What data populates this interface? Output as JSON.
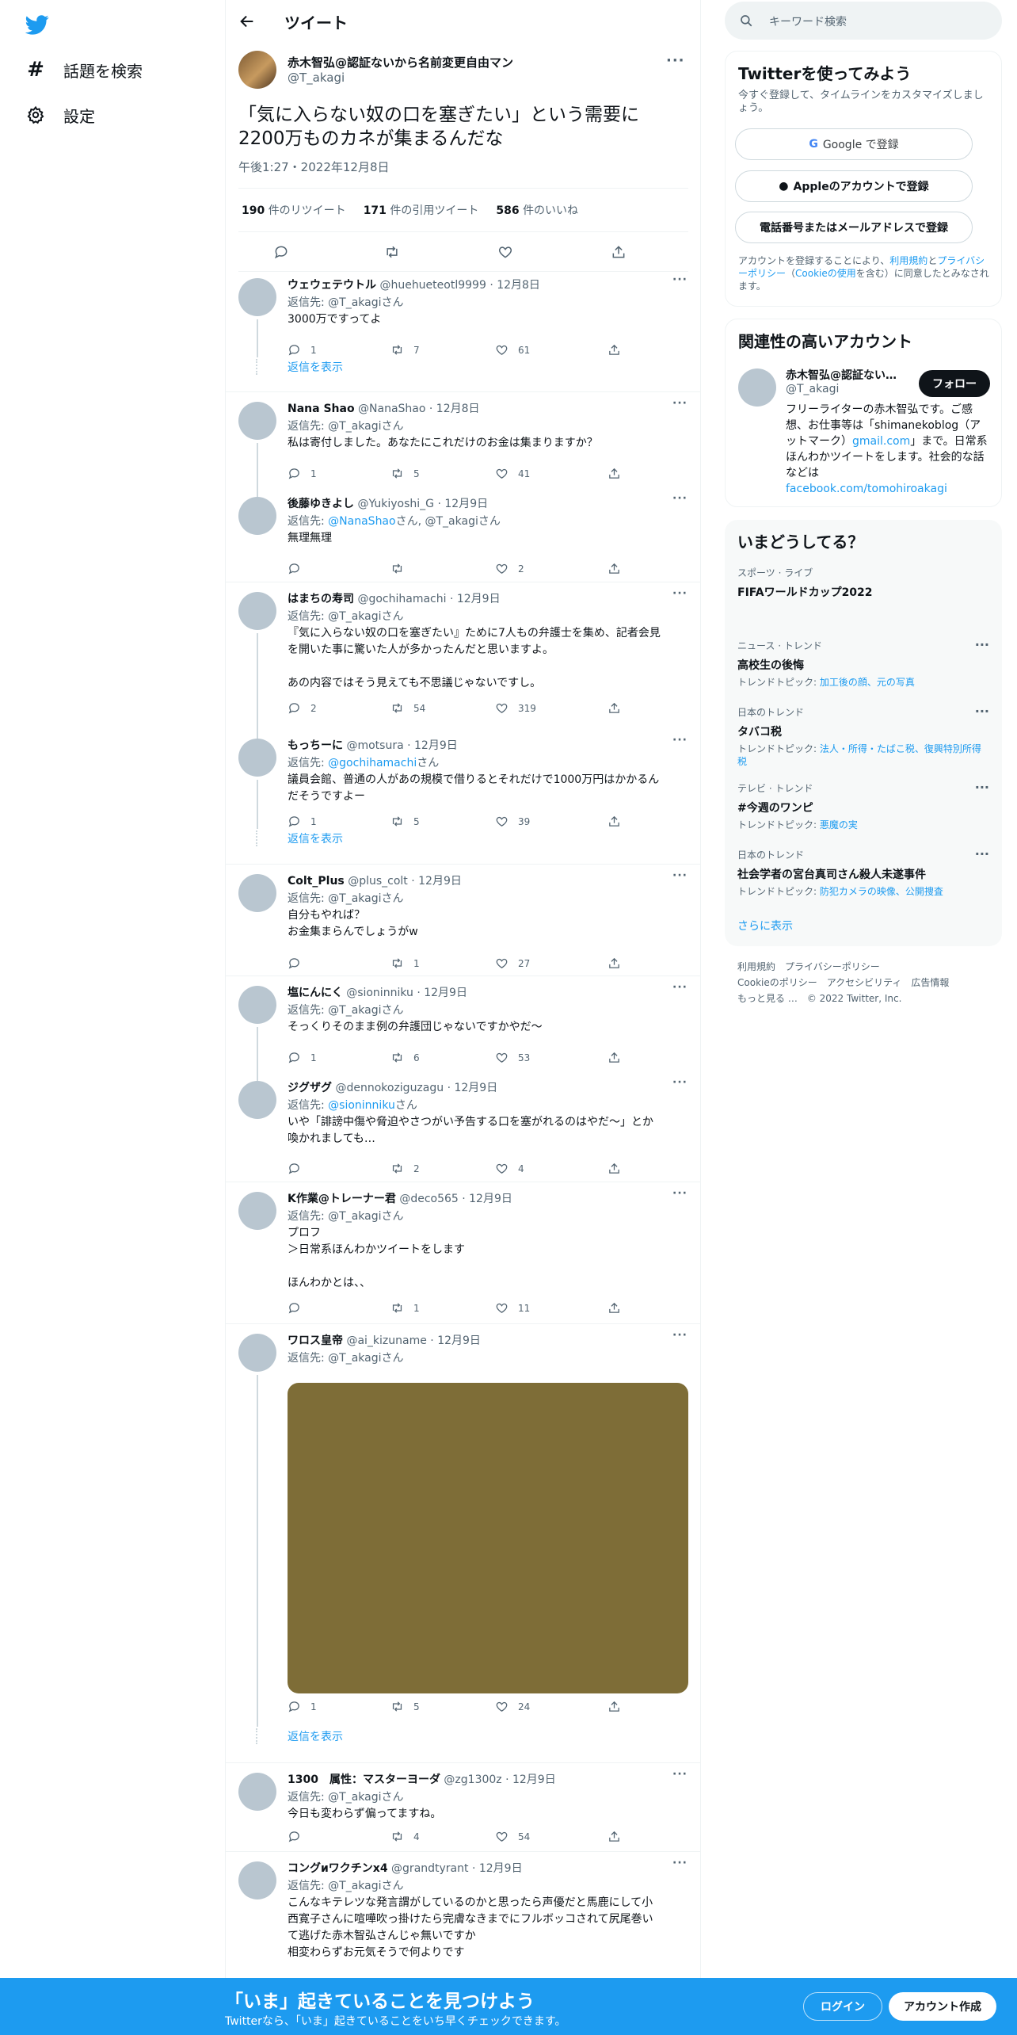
{
  "nav": {
    "explore_label": "話題を検索",
    "settings_label": "設定"
  },
  "header": {
    "title": "ツイート"
  },
  "main_tweet": {
    "name": "赤木智弘@認証ないから名前変更自由マン",
    "handle": "@T_akagi",
    "text": "「気に入らない奴の口を塞ぎたい」という需要に\n2200万ものカネが集まるんだな",
    "time": "午後1:27・2022年12月8日",
    "retweets": "190",
    "retweets_label": "件のリツイート",
    "quotes": "171",
    "quotes_label": "件の引用ツイート",
    "likes": "586",
    "likes_label": "件のいいね"
  },
  "replies": [
    {
      "name": "ウェウェテウトル",
      "handle": "@huehueteotl9999",
      "date": "· 12月8日",
      "to_prefix": "返信先: ",
      "to": "@T_akagiさん",
      "text": "3000万ですってよ",
      "reply": "1",
      "rt": "7",
      "like": "61",
      "show_more": "返信を表示"
    },
    {
      "name": "Nana  Shao",
      "handle": "@NanaShao",
      "date": "· 12月8日",
      "to_prefix": "返信先: ",
      "to": "@T_akagiさん",
      "text": "私は寄付しました。あなたにこれだけのお金は集まりますか？",
      "reply": "1",
      "rt": "5",
      "like": "41"
    },
    {
      "name": "後藤ゆきよし",
      "handle": "@Yukiyoshi_G",
      "date": "· 12月9日",
      "to_prefix": "返信先: ",
      "to_link": "@NanaShao",
      "to_mid": "さん, ",
      "to": "@T_akagiさん",
      "text": "無理無理",
      "reply": "",
      "rt": "",
      "like": "2"
    },
    {
      "name": "はまちの寿司",
      "handle": "@gochihamachi",
      "date": "· 12月9日",
      "to_prefix": "返信先: ",
      "to": "@T_akagiさん",
      "text": "『気に入らない奴の口を塞ぎたい』ために7人もの弁護士を集め、記者会見\nを開いた事に驚いた人が多かったんだと思いますよ。\n\nあの内容ではそう見えても不思議じゃないですし。",
      "reply": "2",
      "rt": "54",
      "like": "319"
    },
    {
      "name": "もっちーに",
      "handle": "@motsura",
      "date": "· 12月9日",
      "to_prefix": "返信先: ",
      "to_link": "@gochihamachi",
      "to_mid": "さん",
      "to": "",
      "text": "議員会館、普通の人があの規模で借りるとそれだけで1000万円はかかるん\nだそうですよー",
      "reply": "1",
      "rt": "5",
      "like": "39",
      "show_more": "返信を表示"
    },
    {
      "name": "Colt_Plus",
      "handle": "@plus_colt",
      "date": "· 12月9日",
      "to_prefix": "返信先: ",
      "to": "@T_akagiさん",
      "text": "自分もやれば？\nお金集まらんでしょうがw",
      "reply": "",
      "rt": "1",
      "like": "27"
    },
    {
      "name": "塩にんにく",
      "handle": "@sioninniku",
      "date": "· 12月9日",
      "to_prefix": "返信先: ",
      "to": "@T_akagiさん",
      "text": "そっくりそのまま例の弁護団じゃないですかやだ～",
      "reply": "1",
      "rt": "6",
      "like": "53"
    },
    {
      "name": "ジグザグ",
      "handle": "@dennokoziguzagu",
      "date": "· 12月9日",
      "to_prefix": "返信先: ",
      "to_link": "@sioninniku",
      "to_mid": "さん",
      "to": "",
      "text": "いや「誹謗中傷や脅迫やさつがい予告する口を塞がれるのはやだ～」とか\n喚かれましても…",
      "reply": "",
      "rt": "2",
      "like": "4"
    },
    {
      "name": "K作業@トレーナー君",
      "handle": "@deco565",
      "date": "· 12月9日",
      "to_prefix": "返信先: ",
      "to": "@T_akagiさん",
      "text": "プロフ\n＞日常系ほんわかツイートをします\n\nほんわかとは、、",
      "reply": "",
      "rt": "1",
      "like": "11"
    },
    {
      "name": "ワロス皇帝",
      "handle": "@ai_kizuname",
      "date": "· 12月9日",
      "to_prefix": "返信先: ",
      "to": "@T_akagiさん",
      "text": "",
      "reply": "1",
      "rt": "5",
      "like": "24",
      "show_more": "返信を表示"
    },
    {
      "name": "1300　属性：マスターヨーダ",
      "handle": "@zg1300z",
      "date": "· 12月9日",
      "to_prefix": "返信先: ",
      "to": "@T_akagiさん",
      "text": "今日も変わらず偏ってますね。",
      "reply": "",
      "rt": "4",
      "like": "54"
    },
    {
      "name": "コングᴎワクチンx4",
      "handle": "@grandtyrant",
      "date": "· 12月9日",
      "to_prefix": "返信先: ",
      "to": "@T_akagiさん",
      "text": "こんなキテレツな発言謂がしているのかと思ったら声優だと馬鹿にして小\n西寛子さんに喧嘩吹っ掛けたら完膚なきまでにフルボッコされて尻尾巻い\nて逃げた赤木智弘さんじゃ無いですか\n相変わらずお元気そうで何よりです"
    }
  ],
  "right": {
    "search_placeholder": "キーワード検索",
    "signup": {
      "title": "Twitterを使ってみよう",
      "subtitle": "今すぐ登録して、タイムラインをカスタマイズしましょう。",
      "google": "Google で登録",
      "apple": "Appleのアカウントで登録",
      "phone": "電話番号またはメールアドレスで登録",
      "terms_1": "アカウントを登録することにより、",
      "terms_link1": "利用規約",
      "terms_2": "と",
      "terms_link2": "プライバシーポリシー",
      "terms_3": "（",
      "terms_link3": "Cookieの使用",
      "terms_4": "を含む）に同意したとみなされます。"
    },
    "related": {
      "title": "関連性の高いアカウント",
      "name": "赤木智弘@認証ない…",
      "handle": "@T_akagi",
      "follow": "フォロー",
      "bio_1": "フリーライターの赤木智弘です。ご感想、お仕事等は「shimanekoblog（アットマーク）",
      "bio_link": "gmail.com",
      "bio_2": "」まで。日常系ほんわかツイートをします。社会的な話などは",
      "bio_link2": "facebook.com/tomohiroakagi"
    },
    "trends": {
      "title": "いまどうしてる？",
      "items": [
        {
          "meta": "スポーツ · ライブ",
          "title": "FIFAワールドカップ2022",
          "topics_label": "",
          "topics": ""
        },
        {
          "meta": "ニュース · トレンド",
          "title": "高校生の後悔",
          "topics_label": "トレンドトピック: ",
          "topics": "加工後の顔、元の写真"
        },
        {
          "meta": "日本のトレンド",
          "title": "タバコ税",
          "topics_label": "トレンドトピック: ",
          "topics": "法人・所得・たばこ税、復興特別所得税"
        },
        {
          "meta": "テレビ · トレンド",
          "title": "#今週のワンピ",
          "topics_label": "トレンドトピック: ",
          "topics": "悪魔の実"
        },
        {
          "meta": "日本のトレンド",
          "title": "社会学者の宮台真司さん殺人未遂事件",
          "topics_label": "トレンドトピック: ",
          "topics": "防犯カメラの映像、公開捜査"
        }
      ],
      "show_more": "さらに表示"
    },
    "footer": {
      "terms": "利用規約",
      "privacy": "プライバシーポリシー",
      "cookie": "Cookieのポリシー",
      "accessibility": "アクセシビリティ",
      "ads": "広告情報",
      "more": "もっと見る …",
      "copyright": "© 2022 Twitter, Inc."
    }
  },
  "bottom_bar": {
    "title": "「いま」起きていることを見つけよう",
    "subtitle": "Twitterなら、「いま」起きていることをいち早くチェックできます。",
    "login": "ログイン",
    "signup": "アカウント作成"
  },
  "colors": {
    "accent": "#1d9bf0",
    "text": "#0f1419",
    "muted": "#536471",
    "border": "#eff3f4",
    "media": "#7e6d37"
  }
}
